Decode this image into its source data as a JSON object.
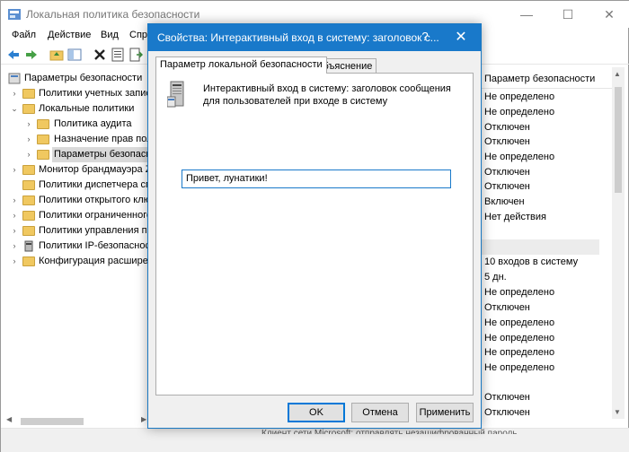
{
  "window": {
    "title": "Локальная политика безопасности",
    "minimize_icon": "minimize-icon",
    "maximize_icon": "maximize-icon",
    "close_icon": "close-icon"
  },
  "menu": [
    "Файл",
    "Действие",
    "Вид",
    "Спра"
  ],
  "tree": [
    {
      "label": "Параметры безопасности",
      "level": 0,
      "arrow": ""
    },
    {
      "label": "Политики учетных записе",
      "level": 1,
      "arrow": "›"
    },
    {
      "label": "Локальные политики",
      "level": 1,
      "arrow": "⌄"
    },
    {
      "label": "Политика аудита",
      "level": 2,
      "arrow": "›"
    },
    {
      "label": "Назначение прав пол",
      "level": 2,
      "arrow": "›"
    },
    {
      "label": "Параметры безопасн",
      "level": 2,
      "arrow": "›"
    },
    {
      "label": "Монитор брандмауэра Z",
      "level": 1,
      "arrow": "›"
    },
    {
      "label": "Политики диспетчера спи",
      "level": 1,
      "arrow": ""
    },
    {
      "label": "Политики открытого клю",
      "level": 1,
      "arrow": "›"
    },
    {
      "label": "Политики ограниченного",
      "level": 1,
      "arrow": "›"
    },
    {
      "label": "Политики управления пр",
      "level": 1,
      "arrow": "›"
    },
    {
      "label": "Политики IP-безопасност",
      "level": 1,
      "arrow": "›"
    },
    {
      "label": "Конфигурация расширен",
      "level": 1,
      "arrow": "›"
    }
  ],
  "right_pane": {
    "header": "Параметр безопасности",
    "values": [
      "Не определено",
      "Не определено",
      "Отключен",
      "Отключен",
      "Не определено",
      "Отключен",
      "Отключен",
      "Включен",
      "Нет действия",
      "",
      "10 входов в систему",
      "5 дн.",
      "Не определено",
      "Отключен",
      "Не определено",
      "Не определено",
      "Не определено",
      "Не определено",
      "",
      "Отключен",
      "Отключен"
    ]
  },
  "statusbar": {
    "clipped_text": "Клиент сети Microsoft: отправлять незашифрованный пароль"
  },
  "dialog": {
    "title": "Свойства: Интерактивный вход в систему: заголовок с...",
    "help": "?",
    "tabs": [
      "Параметр локальной безопасности",
      "Объяснение"
    ],
    "description": "Интерактивный вход в систему: заголовок сообщения для пользователей при входе в систему",
    "message_value": "Привет, лунатики!",
    "buttons": {
      "ok": "OK",
      "cancel": "Отмена",
      "apply": "Применить"
    }
  }
}
